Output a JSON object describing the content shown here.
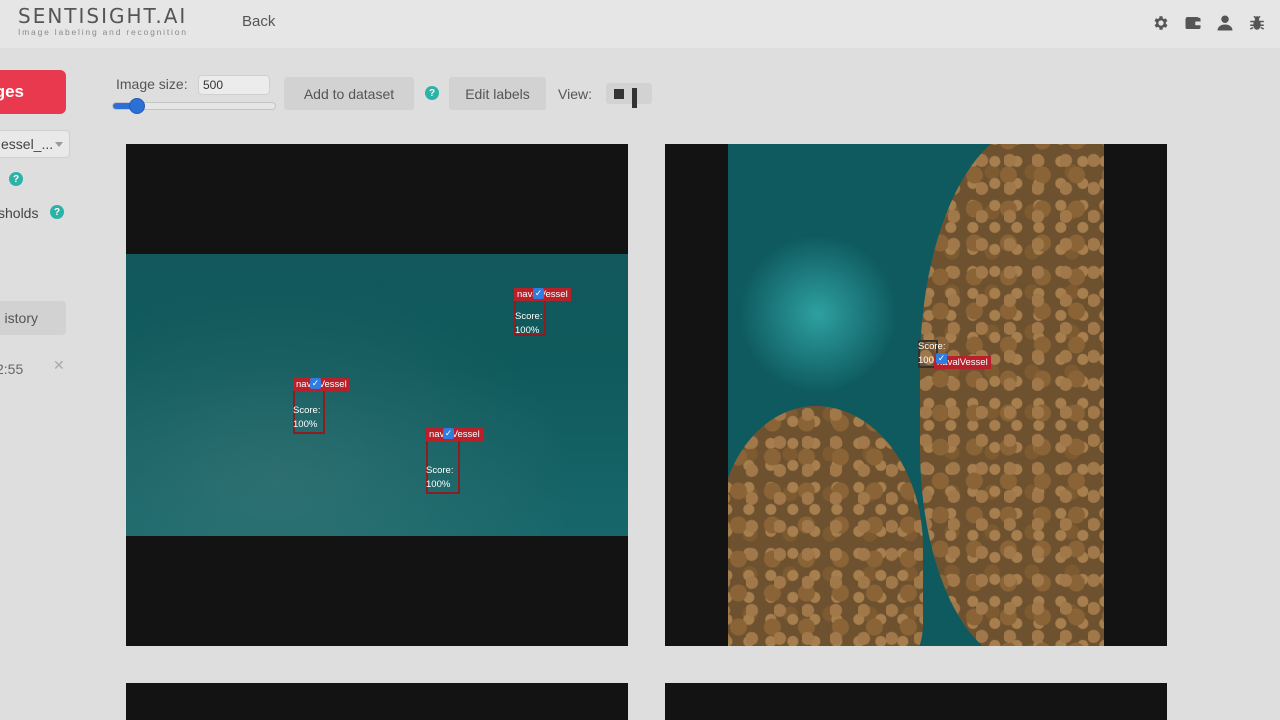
{
  "header": {
    "logo_title": "SENTISIGHT.AI",
    "logo_subtitle": "Image labeling and recognition",
    "back_label": "Back",
    "icons": [
      "gear-icon",
      "wallet-icon",
      "user-icon",
      "bug-icon"
    ]
  },
  "sidebar": {
    "primary_button_label": "ges",
    "model_select_value": "essel_...",
    "thresholds_label": "sholds",
    "history_button_label": "istory",
    "history_entry_time": "2:55"
  },
  "toolbar": {
    "image_size_label": "Image size:",
    "image_size_value": "500",
    "slider_fraction": 0.15,
    "add_to_dataset_label": "Add to dataset",
    "edit_labels_label": "Edit labels",
    "view_label": "View:"
  },
  "results": [
    {
      "detections": [
        {
          "label": "navalVessel",
          "score_label": "Score:",
          "score_value": "100%"
        },
        {
          "label": "navalVessel",
          "score_label": "Score:",
          "score_value": "100%"
        },
        {
          "label": "navalVessel",
          "score_label": "Score:",
          "score_value": "100%"
        }
      ]
    },
    {
      "detections": [
        {
          "label": "navalVessel",
          "score_label": "Score:",
          "score_value": "100%"
        }
      ]
    }
  ],
  "colors": {
    "accent_red": "#e8394e",
    "help_teal": "#2bb3a8",
    "slider_blue": "#2c6fd6",
    "detection_red": "#b8202a"
  }
}
